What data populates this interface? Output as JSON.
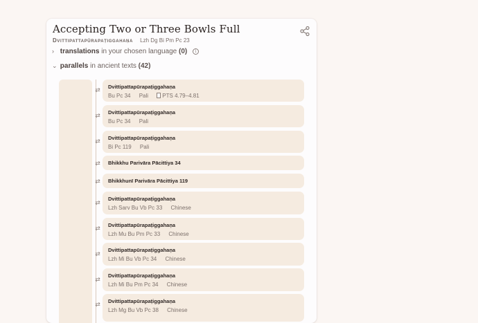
{
  "header": {
    "title": "Accepting Two or Three Bowls Full",
    "pali_title": "Dvittipattapūrapaṭiggahaṇa",
    "ids": "Lzh Dg Bi Pm Pc 23"
  },
  "translations": {
    "label": "translations",
    "suffix": "in your chosen language",
    "count": "(0)"
  },
  "parallels": {
    "label": "parallels",
    "suffix": "in ancient texts",
    "count": "(42)",
    "items": [
      {
        "name": "Dvittipattapūrapaṭiggahaṇa",
        "ref": "Bu Pc 34",
        "lang": "Pali",
        "pts": "PTS 4.79–4.81"
      },
      {
        "name": "Dvittipattapūrapaṭiggahaṇa",
        "ref": "Bu Pc 34",
        "lang": "Pali"
      },
      {
        "name": "Dvittipattapūrapaṭiggahaṇa",
        "ref": "Bi Pc 119",
        "lang": "Pali"
      },
      {
        "name": "Bhikkhu Parivāra Pācittiya 34"
      },
      {
        "name": "Bhikkhunī Parivāra Pācittiya 119"
      },
      {
        "name": "Dvittipattapūrapaṭiggahaṇa",
        "ref": "Lzh Sarv Bu Vb Pc 33",
        "lang": "Chinese"
      },
      {
        "name": "Dvittipattapūrapaṭiggahaṇa",
        "ref": "Lzh Mu Bu Pm Pc 33",
        "lang": "Chinese"
      },
      {
        "name": "Dvittipattapūrapaṭiggahaṇa",
        "ref": "Lzh Mi Bu Vb Pc 34",
        "lang": "Chinese"
      },
      {
        "name": "Dvittipattapūrapaṭiggahaṇa",
        "ref": "Lzh Mi Bu Pm Pc 34",
        "lang": "Chinese"
      },
      {
        "name": "Dvittipattapūrapaṭiggahaṇa",
        "ref": "Lzh Mg Bu Vb Pc 38",
        "lang": "Chinese"
      }
    ]
  },
  "icons": {
    "share": "share-icon",
    "arrow": "parallel-arrows-icon",
    "chevron_right": "chevron-right-icon",
    "chevron_down": "chevron-down-icon",
    "info": "info-icon",
    "pts": "book-icon"
  },
  "colors": {
    "background": "#fbf6f3",
    "card": "#fdfcfd",
    "item": "#f5ebe0"
  }
}
